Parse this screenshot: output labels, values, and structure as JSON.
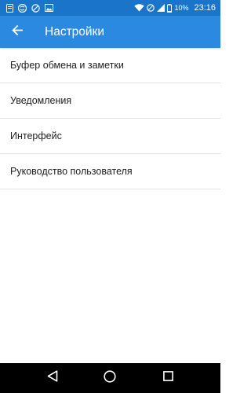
{
  "status_bar": {
    "battery": "10%",
    "time": "23:16",
    "left_icons": [
      "notification-icon",
      "sync-icon",
      "no-sim-icon",
      "image-icon"
    ],
    "right_icons": [
      "wifi-icon",
      "no-sim-icon",
      "signal-icon",
      "battery-icon"
    ]
  },
  "app_bar": {
    "title": "Настройки",
    "back_icon": "arrow-back-icon",
    "color": "#2b8ae0"
  },
  "settings": {
    "items": [
      {
        "label": "Буфер обмена и заметки"
      },
      {
        "label": "Уведомления"
      },
      {
        "label": "Интерфейс"
      },
      {
        "label": "Руководство пользователя"
      }
    ]
  },
  "nav_bar": {
    "buttons": [
      "back-triangle-icon",
      "home-circle-icon",
      "recents-square-icon"
    ]
  }
}
